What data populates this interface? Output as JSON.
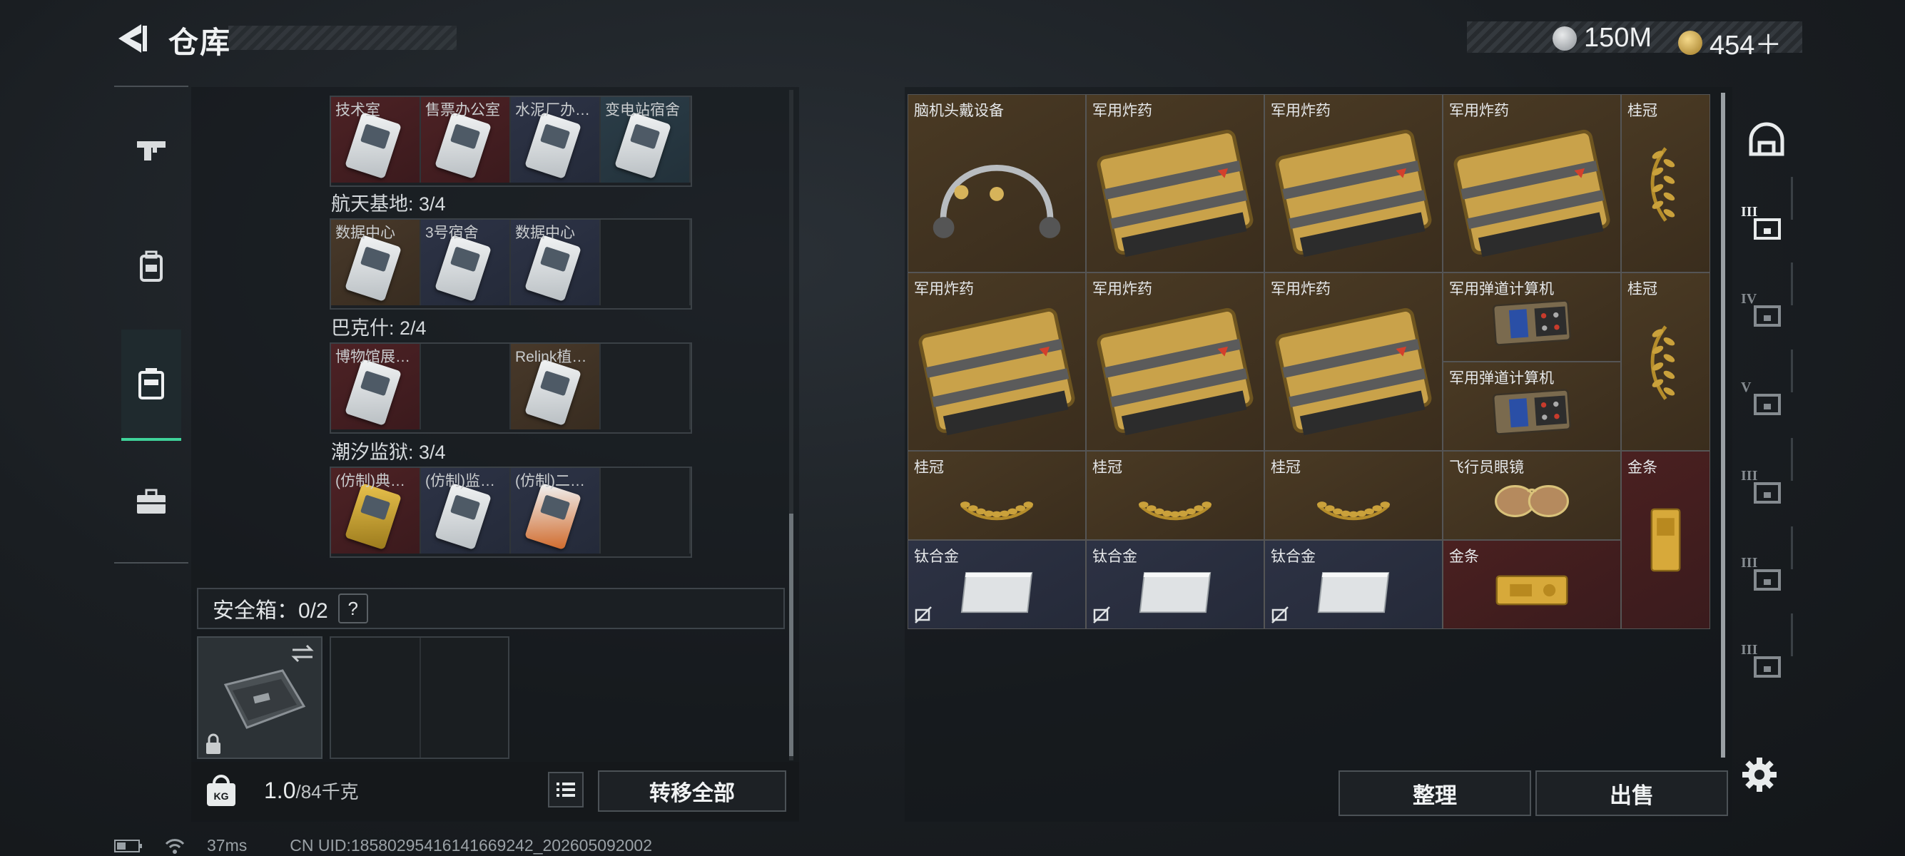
{
  "header": {
    "title": "仓库",
    "currency": [
      {
        "icon": "silver-coin-icon",
        "value": "150M"
      },
      {
        "icon": "gold-coin-icon",
        "value": "454＋"
      }
    ]
  },
  "left_nav": [
    {
      "icon": "gun-icon",
      "active": false
    },
    {
      "icon": "backpack-icon",
      "active": false
    },
    {
      "icon": "rig-vest-icon",
      "active": true
    },
    {
      "icon": "briefcase-icon",
      "active": false
    }
  ],
  "key_sections": [
    {
      "label": "",
      "cells": [
        {
          "name": "技术室",
          "bg": "red"
        },
        {
          "name": "售票办公室",
          "bg": "red"
        },
        {
          "name": "水泥厂办…",
          "bg": "blue"
        },
        {
          "name": "变电站宿舍",
          "bg": "teal"
        }
      ]
    },
    {
      "label": "航天基地: 3/4",
      "cells": [
        {
          "name": "数据中心",
          "bg": "gold"
        },
        {
          "name": "3号宿舍",
          "bg": "blue"
        },
        {
          "name": "数据中心",
          "bg": "blue"
        },
        {
          "name": "",
          "bg": "empty"
        }
      ]
    },
    {
      "label": "巴克什: 2/4",
      "cells": [
        {
          "name": "博物馆展…",
          "bg": "red"
        },
        {
          "name": "",
          "bg": "empty"
        },
        {
          "name": "Relink植…",
          "bg": "gold"
        },
        {
          "name": "",
          "bg": "empty"
        }
      ]
    },
    {
      "label": "潮汐监狱: 3/4",
      "cells": [
        {
          "name": "(仿制)典…",
          "bg": "red"
        },
        {
          "name": "(仿制)监…",
          "bg": "blue"
        },
        {
          "name": "(仿制)二…",
          "bg": "blue"
        },
        {
          "name": "",
          "bg": "empty"
        }
      ]
    }
  ],
  "safe_box": {
    "label": "安全箱：0/2",
    "help": "?"
  },
  "capacity": {
    "current": "1.0",
    "max": "/84千克"
  },
  "buttons": {
    "transfer_all": "转移全部",
    "organize": "整理",
    "sell": "出售"
  },
  "stash_items": [
    {
      "name": "脑机头戴设备",
      "bg": "gold",
      "art": "headset"
    },
    {
      "name": "军用炸药",
      "bg": "gold",
      "art": "explosive"
    },
    {
      "name": "军用炸药",
      "bg": "gold",
      "art": "explosive"
    },
    {
      "name": "军用炸药",
      "bg": "gold",
      "art": "explosive"
    },
    {
      "name": "桂冠",
      "bg": "gold",
      "art": "laurel-vertical"
    },
    {
      "name": "军用炸药",
      "bg": "gold",
      "art": "explosive"
    },
    {
      "name": "军用炸药",
      "bg": "gold",
      "art": "explosive"
    },
    {
      "name": "军用炸药",
      "bg": "gold",
      "art": "explosive"
    },
    {
      "name": "军用弹道计算机",
      "bg": "gold",
      "art": "computer"
    },
    {
      "name": "桂冠",
      "bg": "gold",
      "art": "laurel-vertical"
    },
    {
      "name": "军用弹道计算机",
      "bg": "gold",
      "art": "computer"
    },
    {
      "name": "桂冠",
      "bg": "gold",
      "art": "laurel"
    },
    {
      "name": "桂冠",
      "bg": "gold",
      "art": "laurel"
    },
    {
      "name": "桂冠",
      "bg": "gold",
      "art": "laurel"
    },
    {
      "name": "飞行员眼镜",
      "bg": "gold",
      "art": "glasses"
    },
    {
      "name": "金条",
      "bg": "red",
      "art": "gold-bar-vertical"
    },
    {
      "name": "钛合金",
      "bg": "blue",
      "art": "titanium"
    },
    {
      "name": "钛合金",
      "bg": "blue",
      "art": "titanium"
    },
    {
      "name": "钛合金",
      "bg": "blue",
      "art": "titanium"
    },
    {
      "name": "金条",
      "bg": "red",
      "art": "gold-bar"
    }
  ],
  "right_nav": [
    {
      "icon": "helmet-tab-icon"
    },
    {
      "icon": "level-3-armor-icon",
      "label": "III"
    },
    {
      "icon": "level-4-armor-icon",
      "label": "IV"
    },
    {
      "icon": "level-5-armor-icon",
      "label": "V"
    },
    {
      "icon": "level-3-rig-icon",
      "label": "III"
    },
    {
      "icon": "level-3-bag-icon",
      "label": "III"
    },
    {
      "icon": "level-3-case-icon",
      "label": "III"
    }
  ],
  "status": {
    "ping": "37ms",
    "uid": "CN UID:1858029541614166924​2_202605092002"
  }
}
